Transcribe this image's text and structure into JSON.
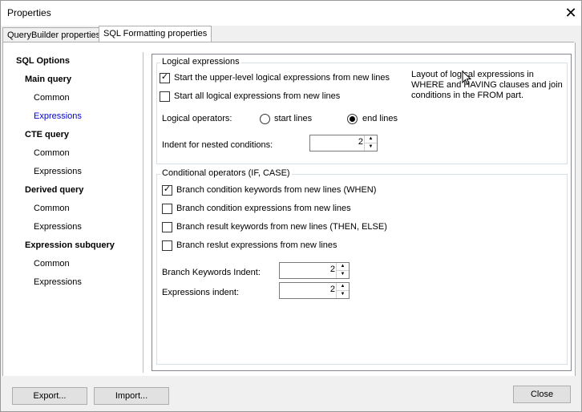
{
  "window": {
    "title": "Properties",
    "close_glyph": "✕"
  },
  "tabs": [
    {
      "label": "QueryBuilder properties"
    },
    {
      "label": "SQL Formatting properties"
    }
  ],
  "tree": {
    "root": "SQL Options",
    "main_query": "Main query",
    "main_common": "Common",
    "main_expressions": "Expressions",
    "cte_query": "CTE query",
    "cte_common": "Common",
    "cte_expressions": "Expressions",
    "derived_query": "Derived query",
    "derived_common": "Common",
    "derived_expressions": "Expressions",
    "expr_subquery": "Expression subquery",
    "expr_common": "Common",
    "expr_expressions": "Expressions"
  },
  "logical": {
    "title": "Logical expressions",
    "start_upper": {
      "label": "Start the upper-level logical expressions from new lines",
      "checked": true
    },
    "start_all": {
      "label": "Start all logical expressions from new lines",
      "checked": false
    },
    "operators_label": "Logical operators:",
    "opt_start": {
      "label": "start lines",
      "selected": false
    },
    "opt_end": {
      "label": "end lines",
      "selected": true
    },
    "indent_label": "Indent for nested conditions:",
    "indent_value": "2",
    "description": "Layout of logical expressions in WHERE and HAVING clauses and join conditions in the FROM part."
  },
  "conditional": {
    "title": "Conditional operators (IF, CASE)",
    "branch_when": {
      "label": "Branch condition keywords from new lines (WHEN)",
      "checked": true
    },
    "branch_cond_expr": {
      "label": "Branch condition expressions from new lines",
      "checked": false
    },
    "branch_result_kw": {
      "label": "Branch result keywords from new lines (THEN, ELSE)",
      "checked": false
    },
    "branch_result_expr": {
      "label": "Branch reslut expressions from new lines",
      "checked": false
    },
    "keywords_indent_label": "Branch Keywords Indent:",
    "keywords_indent_value": "2",
    "expressions_indent_label": "Expressions indent:",
    "expressions_indent_value": "2"
  },
  "footer": {
    "export": "Export...",
    "import": "Import...",
    "close": "Close"
  },
  "colors": {
    "selected_tree": "#0000d8",
    "accent": "#0078d7"
  }
}
